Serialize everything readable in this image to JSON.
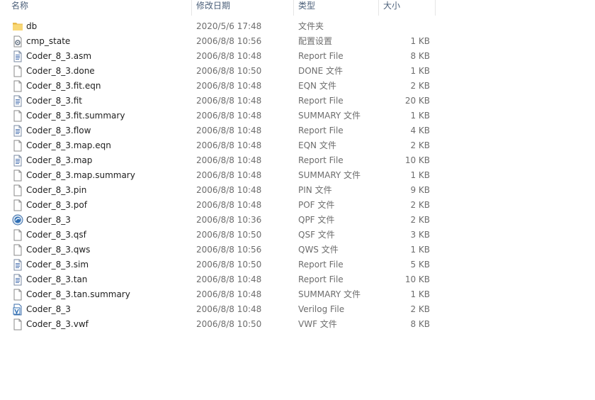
{
  "header": {
    "name": "名称",
    "date": "修改日期",
    "type": "类型",
    "size": "大小"
  },
  "files": [
    {
      "name": "db",
      "date": "2020/5/6 17:48",
      "type": "文件夹",
      "size": "",
      "icon": "folder-icon"
    },
    {
      "name": "cmp_state",
      "date": "2006/8/8 10:56",
      "type": "配置设置",
      "size": "1 KB",
      "icon": "config-file-icon"
    },
    {
      "name": "Coder_8_3.asm",
      "date": "2006/8/8 10:48",
      "type": "Report File",
      "size": "8 KB",
      "icon": "report-file-icon"
    },
    {
      "name": "Coder_8_3.done",
      "date": "2006/8/8 10:50",
      "type": "DONE 文件",
      "size": "1 KB",
      "icon": "blank-file-icon"
    },
    {
      "name": "Coder_8_3.fit.eqn",
      "date": "2006/8/8 10:48",
      "type": "EQN 文件",
      "size": "2 KB",
      "icon": "blank-file-icon"
    },
    {
      "name": "Coder_8_3.fit",
      "date": "2006/8/8 10:48",
      "type": "Report File",
      "size": "20 KB",
      "icon": "report-file-icon"
    },
    {
      "name": "Coder_8_3.fit.summary",
      "date": "2006/8/8 10:48",
      "type": "SUMMARY 文件",
      "size": "1 KB",
      "icon": "blank-file-icon"
    },
    {
      "name": "Coder_8_3.flow",
      "date": "2006/8/8 10:48",
      "type": "Report File",
      "size": "4 KB",
      "icon": "report-file-icon"
    },
    {
      "name": "Coder_8_3.map.eqn",
      "date": "2006/8/8 10:48",
      "type": "EQN 文件",
      "size": "2 KB",
      "icon": "blank-file-icon"
    },
    {
      "name": "Coder_8_3.map",
      "date": "2006/8/8 10:48",
      "type": "Report File",
      "size": "10 KB",
      "icon": "report-file-icon"
    },
    {
      "name": "Coder_8_3.map.summary",
      "date": "2006/8/8 10:48",
      "type": "SUMMARY 文件",
      "size": "1 KB",
      "icon": "blank-file-icon"
    },
    {
      "name": "Coder_8_3.pin",
      "date": "2006/8/8 10:48",
      "type": "PIN 文件",
      "size": "9 KB",
      "icon": "blank-file-icon"
    },
    {
      "name": "Coder_8_3.pof",
      "date": "2006/8/8 10:48",
      "type": "POF 文件",
      "size": "2 KB",
      "icon": "blank-file-icon"
    },
    {
      "name": "Coder_8_3",
      "date": "2006/8/8 10:36",
      "type": "QPF 文件",
      "size": "2 KB",
      "icon": "quartus-project-icon"
    },
    {
      "name": "Coder_8_3.qsf",
      "date": "2006/8/8 10:50",
      "type": "QSF 文件",
      "size": "3 KB",
      "icon": "blank-file-icon"
    },
    {
      "name": "Coder_8_3.qws",
      "date": "2006/8/8 10:56",
      "type": "QWS 文件",
      "size": "1 KB",
      "icon": "blank-file-icon"
    },
    {
      "name": "Coder_8_3.sim",
      "date": "2006/8/8 10:50",
      "type": "Report File",
      "size": "5 KB",
      "icon": "report-file-icon"
    },
    {
      "name": "Coder_8_3.tan",
      "date": "2006/8/8 10:48",
      "type": "Report File",
      "size": "10 KB",
      "icon": "report-file-icon"
    },
    {
      "name": "Coder_8_3.tan.summary",
      "date": "2006/8/8 10:48",
      "type": "SUMMARY 文件",
      "size": "1 KB",
      "icon": "blank-file-icon"
    },
    {
      "name": "Coder_8_3",
      "date": "2006/8/8 10:48",
      "type": "Verilog File",
      "size": "2 KB",
      "icon": "verilog-file-icon"
    },
    {
      "name": "Coder_8_3.vwf",
      "date": "2006/8/8 10:50",
      "type": "VWF 文件",
      "size": "8 KB",
      "icon": "blank-file-icon"
    }
  ],
  "colors": {
    "header_text": "#4c607a",
    "name_text": "#1e1e1e",
    "detail_text": "#6d6d6d",
    "folder": "#f8d775"
  }
}
